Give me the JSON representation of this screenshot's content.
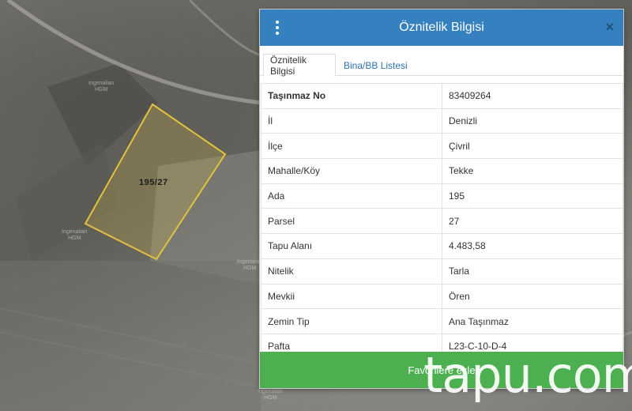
{
  "map": {
    "parcel_label": "195/27",
    "ghost_labels": [
      "Ingenalian\nHGM",
      "Ingenalian\nHGM",
      "Ingenalian\nHGM",
      "Ingenalian\nHGM"
    ]
  },
  "panel": {
    "title": "Öznitelik Bilgisi",
    "tabs": [
      {
        "label": "Öznitelik Bilgisi",
        "active": true
      },
      {
        "label": "Bina/BB Listesi",
        "active": false
      }
    ],
    "rows": [
      {
        "key": "Taşınmaz No",
        "value": "83409264"
      },
      {
        "key": "İl",
        "value": "Denizli"
      },
      {
        "key": "İlçe",
        "value": "Çivril"
      },
      {
        "key": "Mahalle/Köy",
        "value": "Tekke"
      },
      {
        "key": "Ada",
        "value": "195"
      },
      {
        "key": "Parsel",
        "value": "27"
      },
      {
        "key": "Tapu Alanı",
        "value": "4.483,58"
      },
      {
        "key": "Nitelik",
        "value": "Tarla"
      },
      {
        "key": "Mevkii",
        "value": "Ören"
      },
      {
        "key": "Zemin Tip",
        "value": "Ana Taşınmaz"
      },
      {
        "key": "Pafta",
        "value": "L23-C-10-D-4"
      }
    ],
    "favorite_button": "Favorilere ekle"
  },
  "watermark": "tapu.com",
  "colors": {
    "header": "#3580bf",
    "button": "#4caf50",
    "parcel_outline": "#e2c43a",
    "tab_link": "#2f73b0"
  }
}
